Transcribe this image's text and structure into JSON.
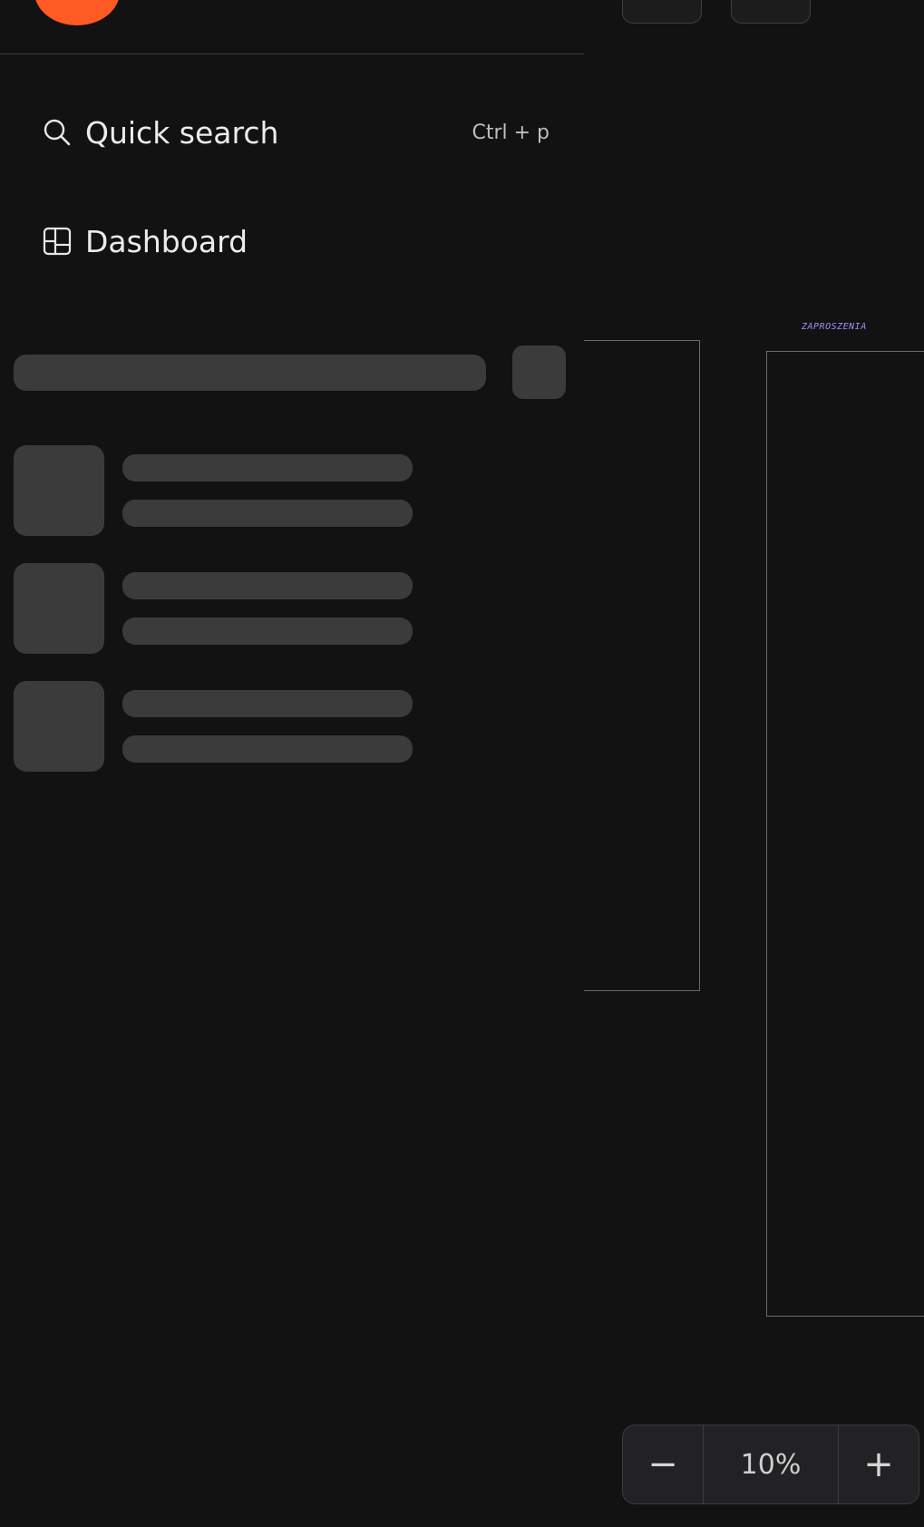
{
  "sidebar": {
    "nav": [
      {
        "icon": "search-icon",
        "label": "Quick search",
        "shortcut": "Ctrl + p"
      },
      {
        "icon": "dashboard-icon",
        "label": "Dashboard"
      }
    ]
  },
  "canvas": {
    "frame_label": "ZAPROSZENIA"
  },
  "zoom": {
    "minus": "−",
    "value": "10%",
    "plus": "+"
  },
  "colors": {
    "background": "#121212",
    "avatar": "#ff5a23",
    "skeleton": "#3b3b3b",
    "frame_label": "#a78bfa"
  }
}
